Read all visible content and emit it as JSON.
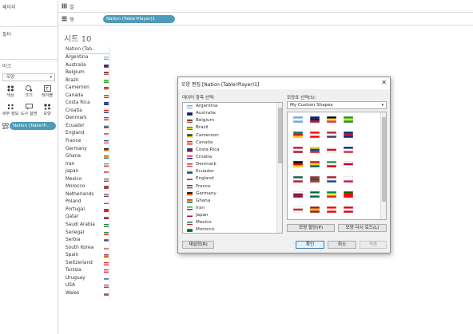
{
  "sidebar": {
    "pages_label": "페이지",
    "filters_label": "필터",
    "marks_label": "마크",
    "mark_type": "모양",
    "mark_buttons": [
      {
        "label": "색상",
        "icon": "palette-icon"
      },
      {
        "label": "크기",
        "icon": "size-icon"
      },
      {
        "label": "레이블",
        "icon": "label-icon"
      },
      {
        "label": "세부 정보",
        "icon": "detail-icon"
      },
      {
        "label": "도구 설명",
        "icon": "tooltip-icon"
      },
      {
        "label": "모양",
        "icon": "shape-icon"
      }
    ],
    "shape_field_pill": "Nation (Table!P..."
  },
  "shelves": {
    "columns_label": "열",
    "rows_label": "행",
    "rows_pill": "Nation (Table!Player)1"
  },
  "sheet": {
    "title": "시트 10",
    "column_header": "Nation (Tab..",
    "countries": [
      "Argentina",
      "Australia",
      "Belgium",
      "Brazil",
      "Cameroon",
      "Canada",
      "Costa Rica",
      "Croatia",
      "Denmark",
      "Ecuador",
      "England",
      "France",
      "Germany",
      "Ghana",
      "Iran",
      "Japan",
      "Mexico",
      "Morocco",
      "Netherlands",
      "Poland",
      "Portugal",
      "Qatar",
      "Saudi Arabia",
      "Senegal",
      "Serbia",
      "South Korea",
      "Spain",
      "Switzerland",
      "Tunisia",
      "Uruguay",
      "USA",
      "Wales"
    ]
  },
  "dialog": {
    "title": "모양 편집 [Nation (Table!Player)1]",
    "data_items_label": "데이터 항목 선택:",
    "palette_label": "모양표 선택(S):",
    "palette_value": "My Custom Shapes",
    "data_items": [
      "Argentina",
      "Australia",
      "Belgium",
      "Brazil",
      "Cameroon",
      "Canada",
      "Costa Rica",
      "Croatia",
      "Denmark",
      "Ecuador",
      "England",
      "France",
      "Germany",
      "Ghana",
      "Iran",
      "Japan",
      "Mexico",
      "Morocco"
    ],
    "assign_palette_button": "모양 할당(P)",
    "reload_shapes_button": "모양 다시 로드(L)",
    "reset_button": "재설정(R)",
    "ok_button": "확인",
    "cancel_button": "취소",
    "apply_button": "적용"
  },
  "flag_colors": {
    "Argentina": [
      "#74acdf",
      "#ffffff",
      "#74acdf"
    ],
    "Australia": [
      "#012169",
      "#012169",
      "#e4002b"
    ],
    "Belgium": [
      "#000000",
      "#fdda24",
      "#ef3340"
    ],
    "Brazil": [
      "#009c3b",
      "#ffdf00",
      "#009c3b"
    ],
    "Cameroon": [
      "#007a5e",
      "#ce1126",
      "#fcd116"
    ],
    "Canada": [
      "#ff0000",
      "#ffffff",
      "#ff0000"
    ],
    "Costa Rica": [
      "#002b7f",
      "#ce1126",
      "#002b7f"
    ],
    "Croatia": [
      "#ff0000",
      "#ffffff",
      "#171796"
    ],
    "Denmark": [
      "#c8102e",
      "#ffffff",
      "#c8102e"
    ],
    "Ecuador": [
      "#ffdd00",
      "#034ea2",
      "#ed1c24"
    ],
    "England": [
      "#ffffff",
      "#ce1124",
      "#ffffff"
    ],
    "France": [
      "#002395",
      "#ffffff",
      "#ed2939"
    ],
    "Germany": [
      "#000000",
      "#dd0000",
      "#ffce00"
    ],
    "Ghana": [
      "#ce1126",
      "#fcd116",
      "#006b3f"
    ],
    "Iran": [
      "#239f40",
      "#ffffff",
      "#da0000"
    ],
    "Japan": [
      "#ffffff",
      "#bc002d",
      "#ffffff"
    ],
    "Mexico": [
      "#006847",
      "#ffffff",
      "#ce1126"
    ],
    "Morocco": [
      "#c1272d",
      "#006233",
      "#c1272d"
    ],
    "Netherlands": [
      "#ae1c28",
      "#ffffff",
      "#21468b"
    ],
    "Poland": [
      "#ffffff",
      "#ffffff",
      "#dc143c"
    ],
    "Portugal": [
      "#006600",
      "#ff0000",
      "#ff0000"
    ],
    "Qatar": [
      "#ffffff",
      "#8a1538",
      "#8a1538"
    ],
    "Saudi Arabia": [
      "#006c35",
      "#ffffff",
      "#006c35"
    ],
    "Senegal": [
      "#00853f",
      "#fdef42",
      "#e31b23"
    ],
    "Serbia": [
      "#c6363c",
      "#0c4076",
      "#ffffff"
    ],
    "South Korea": [
      "#ffffff",
      "#cd2e3a",
      "#ffffff"
    ],
    "Spain": [
      "#aa151b",
      "#f1bf00",
      "#aa151b"
    ],
    "Switzerland": [
      "#ff0000",
      "#ffffff",
      "#ff0000"
    ],
    "Tunisia": [
      "#e70013",
      "#ffffff",
      "#e70013"
    ],
    "Uruguay": [
      "#ffffff",
      "#0038a8",
      "#ffffff"
    ],
    "USA": [
      "#b22234",
      "#ffffff",
      "#3c3b6e"
    ],
    "Wales": [
      "#ffffff",
      "#c8102e",
      "#00b140"
    ]
  },
  "shape_palette": [
    "Argentina",
    "Australia",
    "Belgium",
    "Brazil",
    "Cameroon",
    "Canada",
    "USA",
    "Costa Rica",
    "Denmark",
    "Ecuador",
    "England",
    "France",
    "Germany",
    "Ghana",
    "Iran",
    "Japan",
    "Mexico",
    "Morocco",
    "Netherlands",
    "Poland",
    "Qatar",
    "Saudi Arabia",
    "Senegal",
    "Portugal",
    "South Korea",
    "Spain",
    "Switzerland",
    "Tunisia"
  ]
}
